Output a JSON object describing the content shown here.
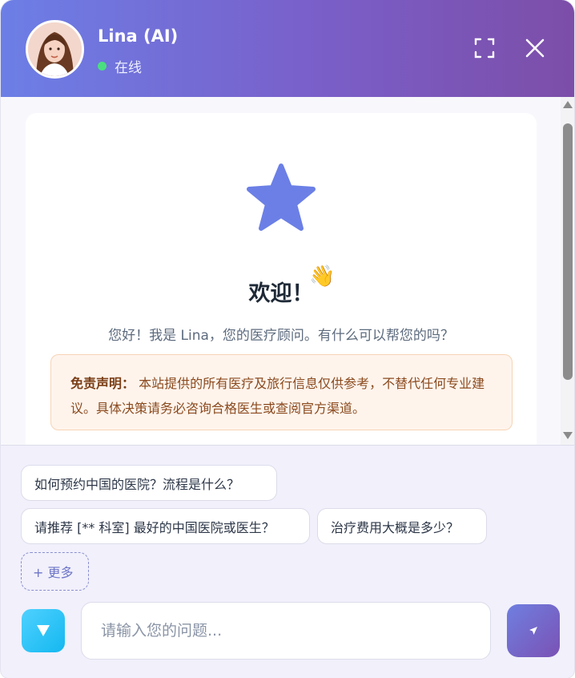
{
  "header": {
    "agent_name": "Lina (AI)",
    "status": "在线",
    "status_color": "#4ade80",
    "gradient_colors": [
      "#6c7fe6",
      "#7c4ea8"
    ],
    "icons": [
      "fullscreen-icon",
      "close-icon"
    ]
  },
  "welcome": {
    "title": "欢迎！",
    "emoji": "👋",
    "subtitle": "您好！我是 Lina，您的医疗顾问。有什么可以帮您的吗？",
    "disclaimer_label": "免责声明：",
    "disclaimer_text": "本站提供的所有医疗及旅行信息仅供参考，不替代任何专业建议。具体决策请务必咨询合格医生或查阅官方渠道。",
    "star_color": "#6b7fe6"
  },
  "suggestions": [
    "如何预约中国的医院？流程是什么？",
    "请推荐 [** 科室] 最好的中国医院或医生？",
    "治疗费用大概是多少？"
  ],
  "more_label": "+ 更多",
  "input": {
    "placeholder": "请输入您的问题...",
    "value": ""
  }
}
